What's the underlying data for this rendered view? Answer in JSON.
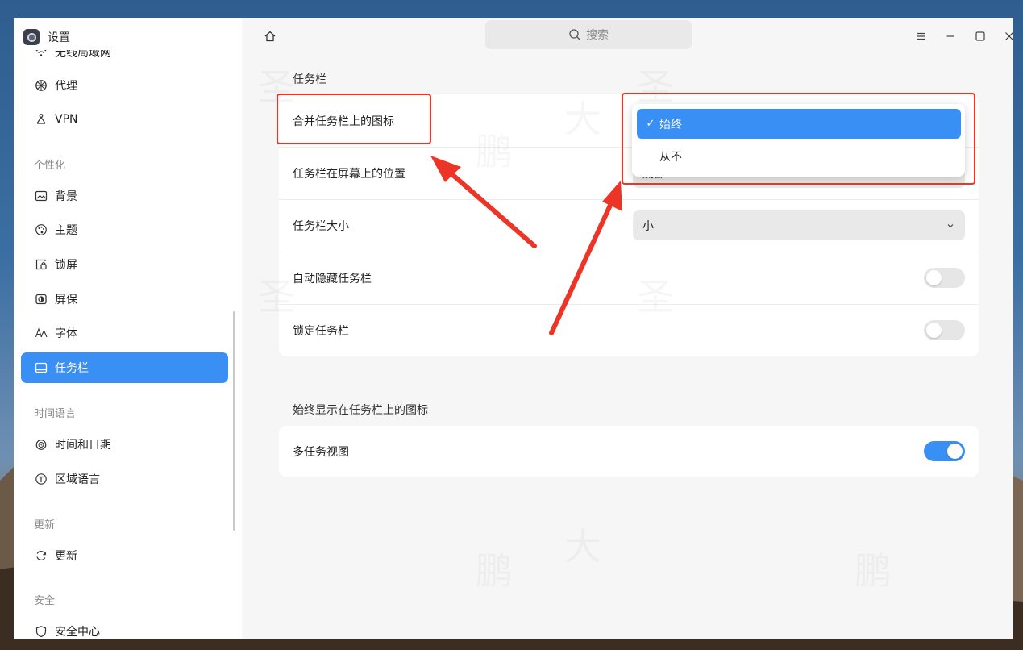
{
  "app": {
    "title": "设置"
  },
  "search": {
    "placeholder": "搜索"
  },
  "sidebar": {
    "items": [
      {
        "label": "无线局域网",
        "icon": "wifi-icon"
      },
      {
        "label": "代理",
        "icon": "proxy-icon"
      },
      {
        "label": "VPN",
        "icon": "vpn-icon"
      },
      {
        "label": "背景",
        "icon": "wallpaper-icon"
      },
      {
        "label": "主题",
        "icon": "palette-icon"
      },
      {
        "label": "锁屏",
        "icon": "lockscreen-icon"
      },
      {
        "label": "屏保",
        "icon": "screensaver-icon"
      },
      {
        "label": "字体",
        "icon": "font-icon"
      },
      {
        "label": "任务栏",
        "icon": "taskbar-icon",
        "active": true
      },
      {
        "label": "时间和日期",
        "icon": "clock-icon"
      },
      {
        "label": "区域语言",
        "icon": "globe-icon"
      },
      {
        "label": "更新",
        "icon": "refresh-icon"
      },
      {
        "label": "安全中心",
        "icon": "shield-icon"
      }
    ],
    "groups": [
      "个性化",
      "时间语言",
      "更新",
      "安全"
    ]
  },
  "main": {
    "section1_title": "任务栏",
    "rows": [
      {
        "label": "合并任务栏上的图标"
      },
      {
        "label": "任务栏在屏幕上的位置",
        "value_partial": "底部"
      },
      {
        "label": "任务栏大小",
        "value": "小"
      },
      {
        "label": "自动隐藏任务栏",
        "toggle": false
      },
      {
        "label": "锁定任务栏",
        "toggle": false
      }
    ],
    "section2_title": "始终显示在任务栏上的图标",
    "always_show": [
      {
        "label": "多任务视图",
        "toggle": true
      }
    ]
  },
  "dropdown": {
    "options": [
      {
        "label": "始终",
        "selected": true
      },
      {
        "label": "从不",
        "selected": false
      }
    ]
  },
  "watermark": {
    "chars": [
      "圣",
      "大",
      "鹏"
    ]
  },
  "colors": {
    "accent": "#3a8ff5",
    "highlight": "#ec3527"
  }
}
